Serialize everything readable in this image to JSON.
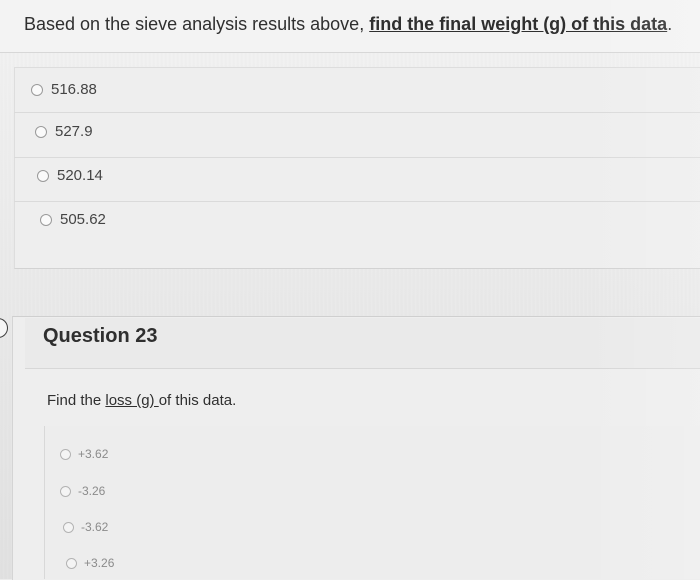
{
  "question22": {
    "prompt_prefix": "Based on the sieve analysis results above, ",
    "prompt_emphasis": "find the final weight (g) of this data",
    "prompt_suffix": ".",
    "options": [
      "516.88",
      "527.9",
      "520.14",
      "505.62"
    ]
  },
  "question23": {
    "title": "Question 23",
    "prompt_prefix": "Find the ",
    "prompt_underlined": "loss (g) ",
    "prompt_suffix": "of this data.",
    "options": [
      "+3.62",
      "-3.26",
      "-3.62",
      "+3.26"
    ]
  },
  "icons": {
    "radio": "radio-circle-icon",
    "nav": "question-marker-icon"
  }
}
